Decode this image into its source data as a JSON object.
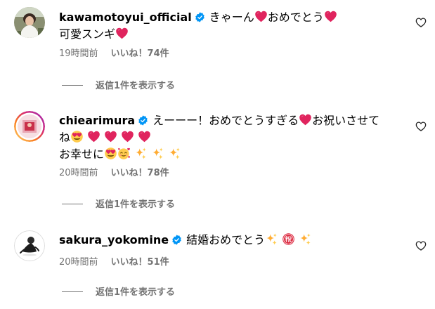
{
  "comments": [
    {
      "username": "kawamotoyui_official",
      "text_line1": "きゃーん",
      "text_line1_b": "おめでとう",
      "text_line2": "可愛スンギ",
      "time": "19時間前",
      "likes": "いいね！74件",
      "replies": "返信1件を表示する"
    },
    {
      "username": "chiearimura",
      "text_line1": "えーーー！おめでとうすぎる",
      "text_line1_b": "お祝いさせて",
      "text_line2": "ね",
      "text_line3": "お幸せに",
      "time": "20時間前",
      "likes": "いいね！78件",
      "replies": "返信1件を表示する"
    },
    {
      "username": "sakura_yokomine",
      "text_line1": "結婚おめでとう",
      "time": "20時間前",
      "likes": "いいね！51件",
      "replies": "返信1件を表示する"
    }
  ],
  "icons": {
    "verified": "verified-badge-icon",
    "like": "heart-outline-icon",
    "heart_emoji": "red-heart-emoji",
    "heart_eyes_emoji": "heart-eyes-emoji",
    "smiling_hearts_emoji": "smiling-face-with-hearts-emoji",
    "sparkles_emoji": "sparkles-emoji",
    "congratulations_emoji": "japanese-congratulations-button-emoji"
  },
  "colors": {
    "text": "#000000",
    "secondary": "#737373",
    "verified": "#0095f6",
    "heart": "#e0245e"
  }
}
